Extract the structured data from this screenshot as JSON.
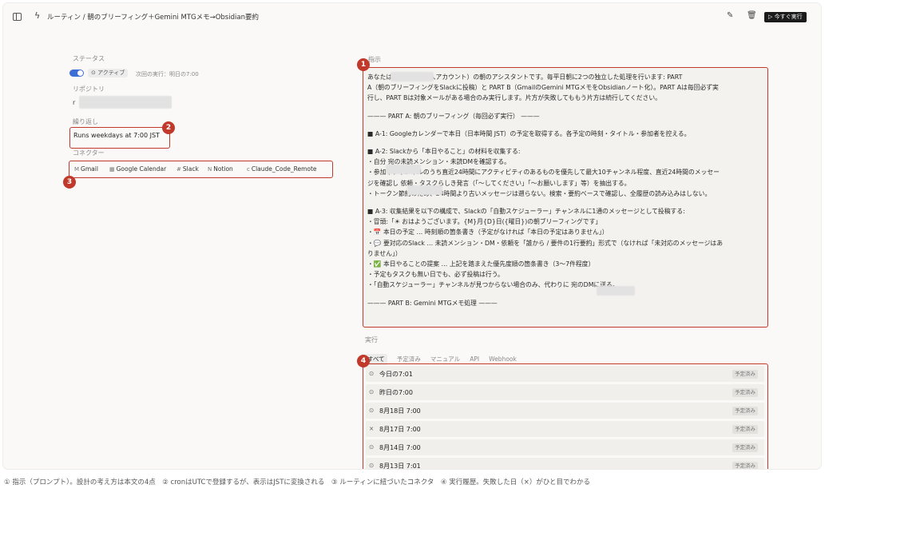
{
  "header": {
    "breadcrumb": "ルーティン / 朝のブリーフィング＋Gemini MTGメモ→Obsidian要約",
    "run_now": "今すぐ実行"
  },
  "status": {
    "label": "ステータス",
    "active": "アクティブ",
    "next_run": "次回の実行：明日の7:00"
  },
  "repository": {
    "label": "リポジトリ",
    "prefix": "r"
  },
  "schedule": {
    "label": "繰り返し",
    "value": "Runs weekdays at 7:00 JST"
  },
  "connectors": {
    "label": "コネクター",
    "items": [
      "Gmail",
      "Google Calendar",
      "Slack",
      "Notion",
      "Claude_Code_Remote"
    ]
  },
  "prompt": {
    "label": "指示",
    "lines": [
      "あなたは                    Slack上の本人アカウント）の朝のアシスタントです。毎平日朝に2つの独立した処理を行います: PART",
      "A（朝のブリーフィングをSlackに投稿）と PART B（GmailのGemini MTGメモをObsidianノート化）。PART Aは毎回必ず実",
      "行し、PART Bは対象メールがある場合のみ実行します。片方が失敗してももう片方は続行してください。",
      "",
      "——— PART A: 朝のブリーフィング（毎回必ず実行） ———",
      "",
      "■ A-1: Googleカレンダーで本日（日本時間 JST）の予定を取得する。各予定の時刻・タイトル・参加者を控える。",
      "",
      "■ A-2: Slackから「本日やること」の材料を収集する:",
      "・自分               宛の未読メンション・未読DMを確認する。",
      "・参加中チャンネルのうち直近24時間にアクティビティのあるものを優先して最大10チャンネル程度、直近24時間のメッセー",
      "ジを確認し               依頼・タスクらしき発言（「〜してください」「〜お願いします」等）を抽出する。",
      "・トークン節約のため、24時間より古いメッセージは遡らない。検索・要約ベースで確認し、全履歴の読み込みはしない。",
      "",
      "■ A-3: 収集結果を以下の構成で、Slackの「自動スケジューラー」チャンネルに1通のメッセージとして投稿する:",
      "・冒頭:「☀ おはようございます。{M}月{D}日({曜日})の朝ブリーフィングです」",
      "・📅 本日の予定 … 時刻順の箇条書き（予定がなければ「本日の予定はありません」）",
      "・💬 要対応のSlack … 未読メンション・DM・依頼を「誰から / 要件の1行要約」形式で（なければ「未対応のメッセージはあ",
      "りません」）",
      "・✅ 本日やることの提案 … 上記を踏まえた優先度順の箇条書き（3〜7件程度）",
      "・予定もタスクも無い日でも、必ず投稿は行う。",
      "・「自動スケジューラー」チャンネルが見つからない場合のみ、代わりに                    宛のDMに送る。",
      "",
      "——— PART B: Gemini MTGメモ処理 ———"
    ]
  },
  "runs": {
    "label": "実行",
    "tabs": [
      "すべて",
      "予定済み",
      "マニュアル",
      "API",
      "Webhook"
    ],
    "items": [
      {
        "status_icon": "clock-icon",
        "date": "今日の7:01",
        "badge": "予定済み"
      },
      {
        "status_icon": "clock-icon",
        "date": "昨日の7:00",
        "badge": "予定済み"
      },
      {
        "status_icon": "clock-icon",
        "date": "8月18日 7:00",
        "badge": "予定済み"
      },
      {
        "status_icon": "x-icon",
        "date": "8月17日 7:00",
        "badge": "予定済み"
      },
      {
        "status_icon": "clock-icon",
        "date": "8月14日 7:00",
        "badge": "予定済み"
      },
      {
        "status_icon": "clock-icon",
        "date": "8月13日 7:01",
        "badge": "予定済み"
      }
    ]
  },
  "callouts": [
    "1",
    "2",
    "3",
    "4"
  ],
  "caption": "① 指示（プロンプト）。設計の考え方は本文の4点　② cronはUTCで登録するが、表示はJSTに変換される　③ ルーティンに紐づいたコネクタ　④ 実行履歴。失敗した日（×）がひと目でわかる",
  "colors": {
    "accent_red": "#c0392b",
    "toggle_blue": "#3b6fd6"
  }
}
